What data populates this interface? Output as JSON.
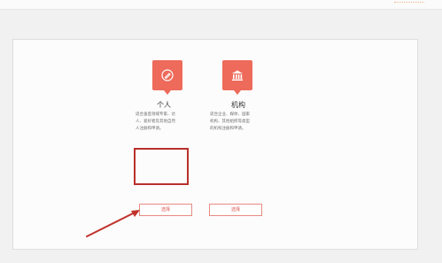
{
  "cards": [
    {
      "id": "personal",
      "icon": "pen-icon",
      "title": "个人",
      "desc_lines": [
        "适合垂直领域专家、达",
        "人、爱好者及其他自然",
        "人注册和申请。"
      ],
      "button_label": "选择"
    },
    {
      "id": "organization",
      "icon": "bank-icon",
      "title": "机构",
      "desc_lines": [
        "适合企业、媒体、国家",
        "机构、其他组织等类型",
        "的机构注册和申请。"
      ],
      "button_label": "选择"
    }
  ],
  "colors": {
    "accent": "#ee6a5a",
    "highlight_border": "#b9302c",
    "button_text": "#d9534f",
    "arrow": "#c2322c"
  }
}
